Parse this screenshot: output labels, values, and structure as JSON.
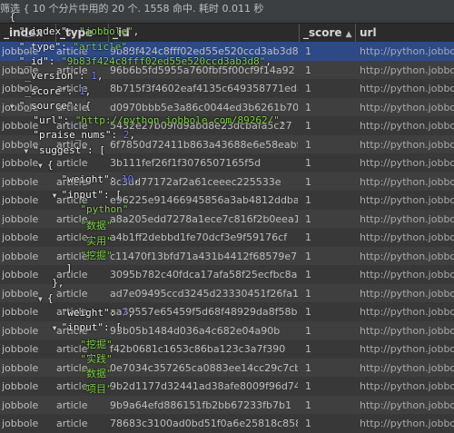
{
  "status": {
    "text": "筛选 { 10 个分片中用的 20 个. 1558 命中. 耗时 0.011 秒"
  },
  "table": {
    "columns": [
      "_index",
      "_type",
      "_id",
      "_score",
      "url"
    ],
    "sorted_column": "_score",
    "sort_icon": "sort-ascending-icon",
    "rows": [
      {
        "index": "jobbole",
        "type": "article",
        "id": "9b83f424c8fff02ed55e520ccd3ab3d8",
        "score": "1",
        "url": "http://python.jobbole"
      },
      {
        "index": "jobbole",
        "type": "article",
        "id": "96b6b5fd5955a760fbf5f00cf9f14a92",
        "score": "1",
        "url": "http://python.jobbole"
      },
      {
        "index": "jobbole",
        "type": "article",
        "id": "8b715f3f4602eaf4135c649358771ed8",
        "score": "1",
        "url": "http://python.jobbole"
      },
      {
        "index": "jobbole",
        "type": "article",
        "id": "d0970bbb5e3a86c0044ed3b6261b70922",
        "score": "1",
        "url": "http://python.jobbole"
      },
      {
        "index": "jobbole",
        "type": "article",
        "id": "5432e27b09fd9abd8e23dcbafa5c27",
        "score": "1",
        "url": "http://python.jobbole"
      },
      {
        "index": "jobbole",
        "type": "article",
        "id": "6f7850d72411b863a43688e6e58eabf0",
        "score": "1",
        "url": "http://python.jobbole"
      },
      {
        "index": "jobbole",
        "type": "article",
        "id": "3b111fef26f1f3076507165f5d",
        "score": "1",
        "url": "http://python.jobbole"
      },
      {
        "index": "jobbole",
        "type": "article",
        "id": "8c3dd77172af2a61ceeec225533e",
        "score": "1",
        "url": "http://python.jobbole"
      },
      {
        "index": "jobbole",
        "type": "article",
        "id": "e96225e91466945856a3ab4812ddbaf7",
        "score": "1",
        "url": "http://python.jobbole"
      },
      {
        "index": "jobbole",
        "type": "article",
        "id": "a8a205edd7278a1ece7c816f2b0eea1",
        "score": "1",
        "url": "http://python.jobbole"
      },
      {
        "index": "jobbole",
        "type": "article",
        "id": "a4b1ff2debbd1fe70dcf3e9f59176cf",
        "score": "1",
        "url": "http://python.jobbole"
      },
      {
        "index": "jobbole",
        "type": "article",
        "id": "c11470f13bfd71a431b4412f68579e7",
        "score": "1",
        "url": "http://python.jobbole"
      },
      {
        "index": "jobbole",
        "type": "article",
        "id": "3095b782c40fdca17afa58f25ecfbc8a",
        "score": "1",
        "url": "http://python.jobbole"
      },
      {
        "index": "jobbole",
        "type": "article",
        "id": "ad7e09495ccd3245d23330451f26fa18",
        "score": "1",
        "url": "http://python.jobbole"
      },
      {
        "index": "jobbole",
        "type": "article",
        "id": "aa39557e65459f5d68f48929da8f58bc",
        "score": "1",
        "url": "http://python.jobbole"
      },
      {
        "index": "jobbole",
        "type": "article",
        "id": "93b05b1484d036a4c682e04a90b",
        "score": "1",
        "url": "http://python.jobbole"
      },
      {
        "index": "jobbole",
        "type": "article",
        "id": "f42b0681c1653c86ba123c3a7f390",
        "score": "1",
        "url": "http://python.jobbole"
      },
      {
        "index": "jobbole",
        "type": "article",
        "id": "0e7034c357265ca0883ee14cc29c7cb2",
        "score": "1",
        "url": "http://python.jobbole"
      },
      {
        "index": "jobbole",
        "type": "article",
        "id": "9b2d1177d32441ad38afe8009f96d74",
        "score": "1",
        "url": "http://python.jobbole"
      },
      {
        "index": "jobbole",
        "type": "article",
        "id": "9b9a64efd886151fb2bb67233fb7b1",
        "score": "1",
        "url": "http://python.jobbole"
      },
      {
        "index": "jobbole",
        "type": "article",
        "id": "78683c3100ad0bd51f0a6e25818c8582",
        "score": "1",
        "url": "http://python.jobbole"
      }
    ]
  },
  "tooltip": {
    "lines": [
      {
        "ind": 2,
        "tri": "",
        "parts": [
          [
            "p",
            "{"
          ]
        ]
      },
      {
        "ind": 4,
        "tri": "",
        "parts": [
          [
            "k",
            "\"_index\": "
          ],
          [
            "s",
            "\"jobbole\""
          ],
          [
            "p",
            ","
          ]
        ]
      },
      {
        "ind": 4,
        "tri": "",
        "parts": [
          [
            "k",
            "\"_type\": "
          ],
          [
            "s",
            "\"article\""
          ],
          [
            "p",
            ","
          ]
        ]
      },
      {
        "ind": 4,
        "tri": "",
        "parts": [
          [
            "k",
            "\"_id\": "
          ],
          [
            "s",
            "\"9b83f424c8fff02ed55e520ccd3ab3d8\""
          ],
          [
            "p",
            ","
          ]
        ]
      },
      {
        "ind": 4,
        "tri": "",
        "parts": [
          [
            "k",
            "\"_version\": "
          ],
          [
            "n",
            "1"
          ],
          [
            "p",
            ","
          ]
        ]
      },
      {
        "ind": 4,
        "tri": "",
        "parts": [
          [
            "k",
            "\"_score\": "
          ],
          [
            "n",
            "1"
          ],
          [
            "p",
            ","
          ]
        ]
      },
      {
        "ind": 4,
        "tri": "▼",
        "parts": [
          [
            "k",
            "\"_source\": "
          ],
          [
            "p",
            "{"
          ]
        ]
      },
      {
        "ind": 7,
        "tri": "",
        "parts": [
          [
            "k",
            "\"url\": "
          ],
          [
            "s",
            "\"http://python.jobbole.com/89262/\""
          ],
          [
            "p",
            ","
          ]
        ]
      },
      {
        "ind": 7,
        "tri": "",
        "parts": [
          [
            "k",
            "\"praise_nums\": "
          ],
          [
            "n",
            "2"
          ],
          [
            "p",
            ","
          ]
        ]
      },
      {
        "ind": 7,
        "tri": "▼",
        "parts": [
          [
            "k",
            "\"suggest\": "
          ],
          [
            "p",
            "["
          ]
        ]
      },
      {
        "ind": 10,
        "tri": "▼",
        "parts": [
          [
            "p",
            "{"
          ]
        ]
      },
      {
        "ind": 13,
        "tri": "",
        "parts": [
          [
            "k",
            "\"weight\": "
          ],
          [
            "n",
            "10"
          ],
          [
            "p",
            ","
          ]
        ]
      },
      {
        "ind": 13,
        "tri": "▼",
        "parts": [
          [
            "k",
            "\"input\": "
          ],
          [
            "p",
            "["
          ]
        ]
      },
      {
        "ind": 17,
        "tri": "",
        "parts": [
          [
            "s",
            "\"python\""
          ]
        ]
      },
      {
        "ind": 17,
        "tri": "",
        "parts": [
          [
            "s",
            "\"数据\""
          ]
        ]
      },
      {
        "ind": 17,
        "tri": "",
        "parts": [
          [
            "s",
            "\"实用\""
          ]
        ]
      },
      {
        "ind": 17,
        "tri": "",
        "parts": [
          [
            "s",
            "\"挖掘\""
          ]
        ]
      },
      {
        "ind": 14,
        "tri": "",
        "parts": [
          [
            "p",
            "]"
          ]
        ]
      },
      {
        "ind": 11,
        "tri": "",
        "parts": [
          [
            "p",
            "},"
          ]
        ]
      },
      {
        "ind": 10,
        "tri": "▼",
        "parts": [
          [
            "p",
            "{"
          ]
        ]
      },
      {
        "ind": 13,
        "tri": "",
        "parts": [
          [
            "k",
            "\"weight\": "
          ],
          [
            "n",
            "7"
          ],
          [
            "p",
            ","
          ]
        ]
      },
      {
        "ind": 13,
        "tri": "▼",
        "parts": [
          [
            "k",
            "\"input\": "
          ],
          [
            "p",
            "["
          ]
        ]
      },
      {
        "ind": 17,
        "tri": "",
        "parts": [
          [
            "s",
            "\"挖掘\""
          ]
        ]
      },
      {
        "ind": 17,
        "tri": "",
        "parts": [
          [
            "s",
            "\"实践\""
          ]
        ]
      },
      {
        "ind": 17,
        "tri": "",
        "parts": [
          [
            "s",
            "\"数据\""
          ]
        ]
      },
      {
        "ind": 17,
        "tri": "",
        "parts": [
          [
            "s",
            "\"项目\""
          ]
        ]
      }
    ]
  }
}
